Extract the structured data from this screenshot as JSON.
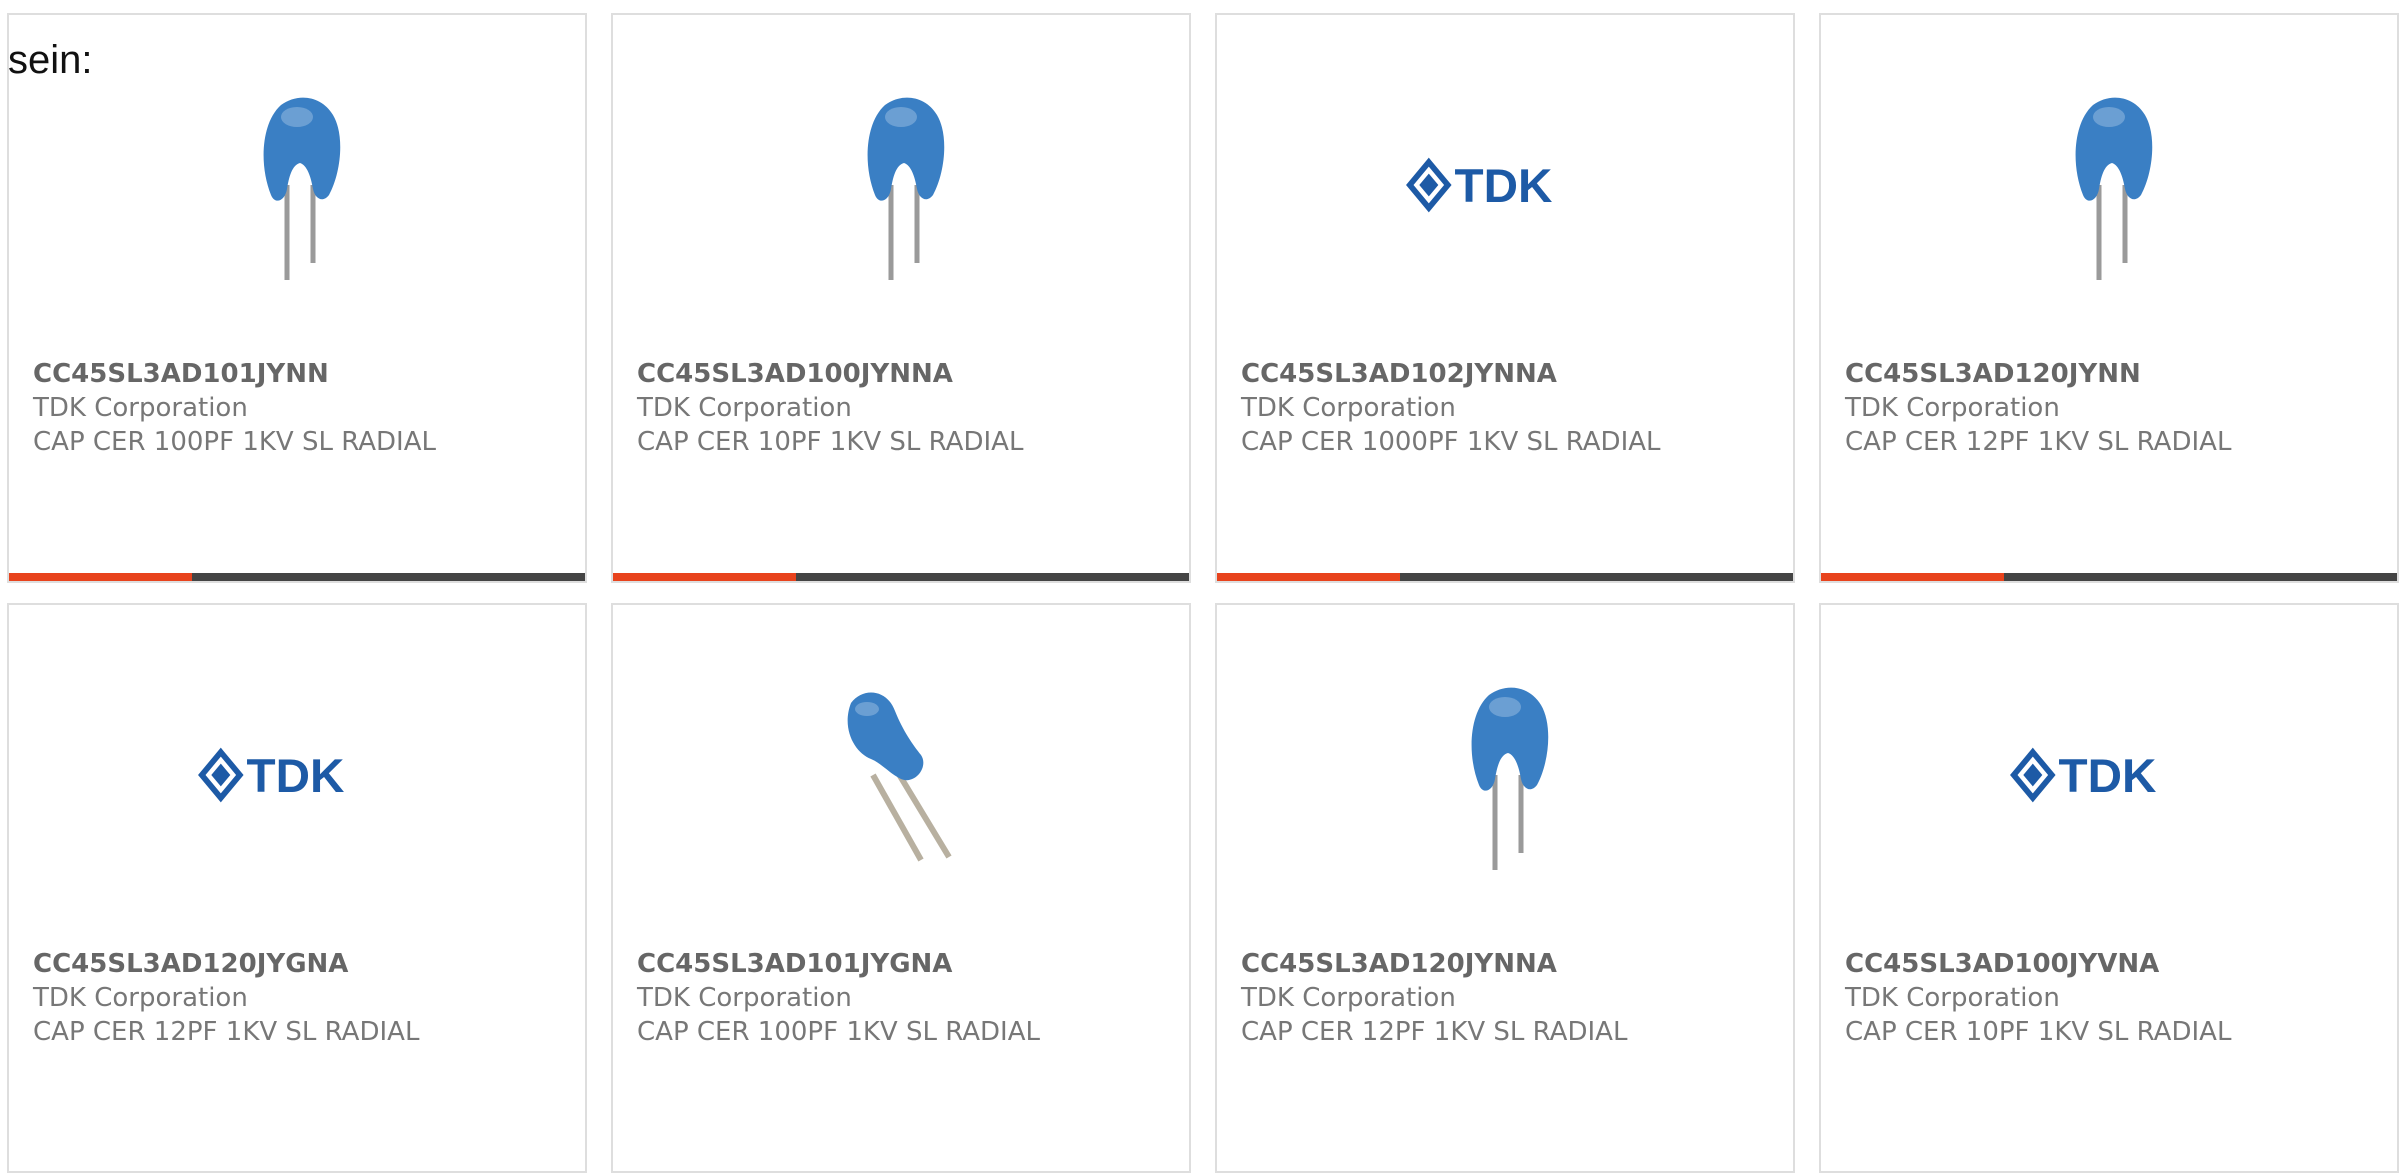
{
  "intro_text": "sein:",
  "colors": {
    "accent_bar": "#e8431d",
    "dark_bar": "#444444",
    "capacitor_blue": "#3a7fc4",
    "tdk_blue": "#1d5aa6"
  },
  "products": [
    {
      "part": "CC45SL3AD101JYNN",
      "maker": "TDK Corporation",
      "desc": "CAP CER 100PF 1KV SL RADIAL",
      "image": "capacitor-icon",
      "bar": true
    },
    {
      "part": "CC45SL3AD100JYNNA",
      "maker": "TDK Corporation",
      "desc": "CAP CER 10PF 1KV SL RADIAL",
      "image": "capacitor-icon",
      "bar": true
    },
    {
      "part": "CC45SL3AD102JYNNA",
      "maker": "TDK Corporation",
      "desc": "CAP CER 1000PF 1KV SL RADIAL",
      "image": "tdk-logo",
      "bar": true
    },
    {
      "part": "CC45SL3AD120JYNN",
      "maker": "TDK Corporation",
      "desc": "CAP CER 12PF 1KV SL RADIAL",
      "image": "capacitor-icon",
      "bar": true
    },
    {
      "part": "CC45SL3AD120JYGNA",
      "maker": "TDK Corporation",
      "desc": "CAP CER 12PF 1KV SL RADIAL",
      "image": "tdk-logo",
      "bar": false
    },
    {
      "part": "CC45SL3AD101JYGNA",
      "maker": "TDK Corporation",
      "desc": "CAP CER 100PF 1KV SL RADIAL",
      "image": "capacitor-bent-icon",
      "bar": false
    },
    {
      "part": "CC45SL3AD120JYNNA",
      "maker": "TDK Corporation",
      "desc": "CAP CER 12PF 1KV SL RADIAL",
      "image": "capacitor-icon",
      "bar": false
    },
    {
      "part": "CC45SL3AD100JYVNA",
      "maker": "TDK Corporation",
      "desc": "CAP CER 10PF 1KV SL RADIAL",
      "image": "tdk-logo",
      "bar": false
    }
  ],
  "logo_text": "TDK"
}
